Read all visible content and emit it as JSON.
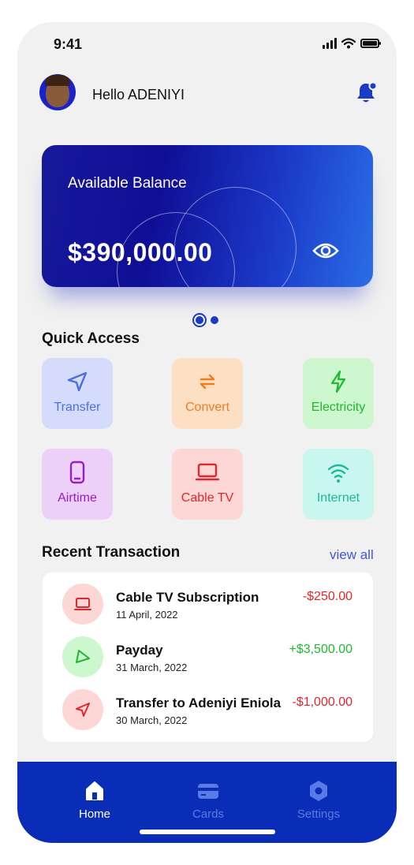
{
  "status_bar": {
    "time": "9:41"
  },
  "header": {
    "greeting": "Hello ADENIYI"
  },
  "balance_card": {
    "label": "Available Balance",
    "amount": "$390,000.00"
  },
  "quick_access": {
    "title": "Quick Access",
    "items": [
      {
        "label": "Transfer",
        "icon": "send-icon",
        "bg": "#d5dcfb",
        "color": "#4b6fe0"
      },
      {
        "label": "Convert",
        "icon": "convert-icon",
        "bg": "#fde0c4",
        "color": "#f07c1c"
      },
      {
        "label": "Electricity",
        "icon": "electricity-icon",
        "bg": "#ccf7cf",
        "color": "#1fb82f"
      },
      {
        "label": "Airtime",
        "icon": "phone-icon",
        "bg": "#ecd0f7",
        "color": "#9a1cc4"
      },
      {
        "label": "Cable TV",
        "icon": "laptop-icon",
        "bg": "#fdd6d6",
        "color": "#e0262e"
      },
      {
        "label": "Internet",
        "icon": "wifi-icon",
        "bg": "#c9f7f0",
        "color": "#1cb89a"
      }
    ]
  },
  "recent": {
    "title": "Recent Transaction",
    "view_all": "view all",
    "items": [
      {
        "name": "Cable TV Subscription",
        "date": "11 April, 2022",
        "amount": "-$250.00",
        "kind": "debit",
        "icon": "laptop-icon"
      },
      {
        "name": "Payday",
        "date": "31 March, 2022",
        "amount": "+$3,500.00",
        "kind": "credit",
        "icon": "send-icon"
      },
      {
        "name": "Transfer to Adeniyi Eniola",
        "date": "30 March, 2022",
        "amount": "-$1,000.00",
        "kind": "debit",
        "icon": "send-icon"
      }
    ]
  },
  "bottom_nav": {
    "items": [
      {
        "label": "Home",
        "icon": "home-icon",
        "active": true
      },
      {
        "label": "Cards",
        "icon": "card-icon",
        "active": false
      },
      {
        "label": "Settings",
        "icon": "settings-icon",
        "active": false
      }
    ]
  },
  "colors": {
    "primary": "#0a2db8",
    "debit": "#e0262e",
    "credit": "#1fb82f"
  }
}
